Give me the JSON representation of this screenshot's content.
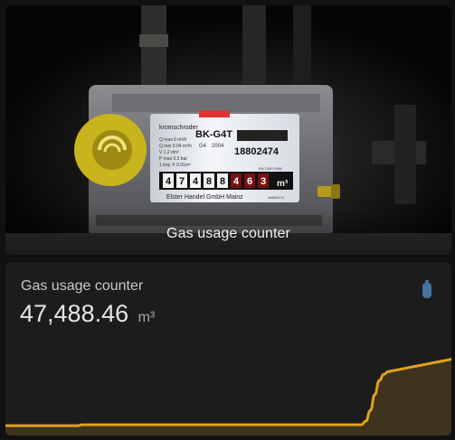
{
  "picture_card": {
    "caption": "Gas usage counter",
    "meter": {
      "brand_line1": "kromschroder",
      "model": "BK-G4T",
      "serial": "18802474",
      "serial_small": "18802474",
      "spec_g": "G4",
      "spec_year": "2004",
      "spec_qmax": "Q max 6 m³/h",
      "spec_qmin": "Q min 0.04 m³/h",
      "spec_v": "V 1.2 dm³",
      "spec_pmax": "P max 0.5 bar",
      "spec_imp": "1 imp ≙ 0.01m³",
      "counter_black": [
        "4",
        "7",
        "4",
        "8",
        "8"
      ],
      "counter_red": [
        "4",
        "6",
        "3"
      ],
      "unit": "m³",
      "maker": "Elster Handel GmbH Mainz",
      "en": "EN 1359 1998"
    }
  },
  "sensor_card": {
    "name": "Gas usage counter",
    "value": "47,488.46",
    "unit": "m³",
    "icon": "gas-cylinder-icon",
    "icon_color": "#44739e",
    "graph_color": "#e0a020",
    "graph_trend": [
      0.05,
      0.05,
      0.05,
      0.05,
      0.05,
      0.05,
      0.05,
      0.05,
      0.05,
      0.05,
      0.05,
      0.05,
      0.05,
      0.05,
      0.05,
      0.05,
      0.05,
      0.06,
      0.06,
      0.06,
      0.06,
      0.06,
      0.06,
      0.06,
      0.06,
      0.06,
      0.06,
      0.06,
      0.06,
      0.06,
      0.06,
      0.06,
      0.06,
      0.06,
      0.06,
      0.06,
      0.06,
      0.06,
      0.06,
      0.06,
      0.06,
      0.06,
      0.06,
      0.06,
      0.06,
      0.06,
      0.06,
      0.06,
      0.06,
      0.06,
      0.06,
      0.06,
      0.06,
      0.06,
      0.06,
      0.06,
      0.06,
      0.06,
      0.06,
      0.06,
      0.06,
      0.06,
      0.06,
      0.06,
      0.06,
      0.06,
      0.06,
      0.06,
      0.06,
      0.06,
      0.06,
      0.06,
      0.06,
      0.06,
      0.06,
      0.06,
      0.06,
      0.06,
      0.06,
      0.06,
      0.1,
      0.22,
      0.4,
      0.56,
      0.63,
      0.66,
      0.67,
      0.68,
      0.69,
      0.7,
      0.71,
      0.72,
      0.73,
      0.74,
      0.75,
      0.76,
      0.77,
      0.78,
      0.79,
      0.8
    ]
  }
}
